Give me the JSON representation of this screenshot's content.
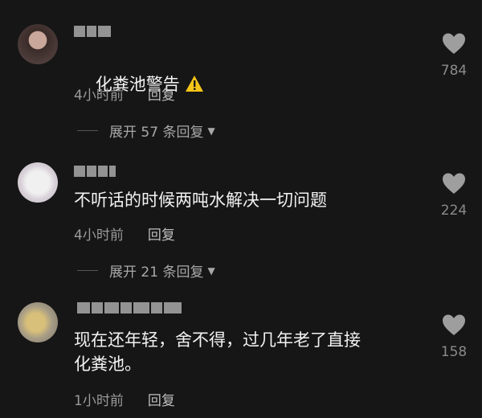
{
  "comments": [
    {
      "text": "化粪池警告",
      "time": "4小时前",
      "reply_label": "回复",
      "expand_label": "展开 57 条回复",
      "likes": "784",
      "has_warning_icon": true
    },
    {
      "text": "不听话的时候两吨水解决一切问题",
      "time": "4小时前",
      "reply_label": "回复",
      "expand_label": "展开 21 条回复",
      "likes": "224"
    },
    {
      "text": "现在还年轻，舍不得，过几年老了直接\n化粪池。",
      "time": "1小时前",
      "reply_label": "回复",
      "likes": "158"
    }
  ],
  "colors": {
    "background": "#161616",
    "text": "#f2f2f2",
    "meta": "#9a9a9a",
    "heart": "#9e9e9e",
    "warning": "#f5c518"
  },
  "icons": [
    "heart-icon",
    "warning-icon",
    "caret-down-icon"
  ]
}
